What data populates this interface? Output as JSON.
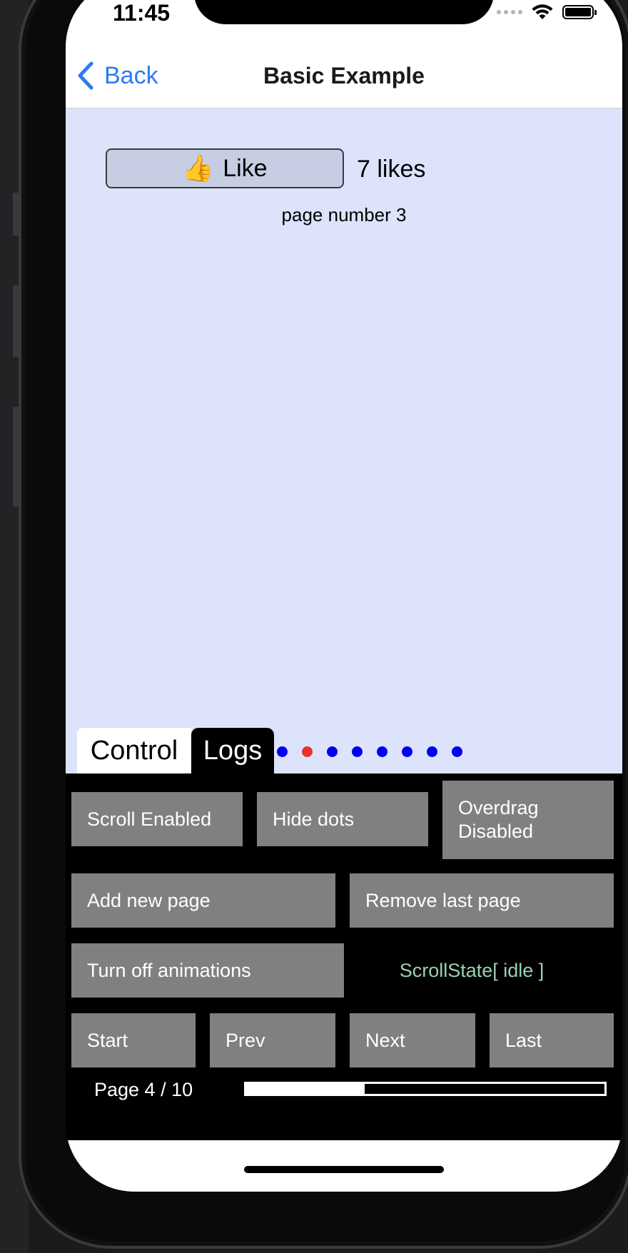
{
  "status": {
    "time": "11:45"
  },
  "nav": {
    "back_label": "Back",
    "title": "Basic Example"
  },
  "content": {
    "like_button_label": "Like",
    "likes_count": "7 likes",
    "page_number_label": "page number 3"
  },
  "tabs": [
    {
      "label": "Control",
      "active": false
    },
    {
      "label": "Logs",
      "active": true
    }
  ],
  "dots": {
    "count": 8,
    "active_index": 1,
    "active_color": "#e8322a",
    "inactive_color": "#0000f0"
  },
  "controls": {
    "scroll_enabled": "Scroll Enabled",
    "hide_dots": "Hide dots",
    "overdrag_line1": "Overdrag",
    "overdrag_line2": "Disabled",
    "add_new_page": "Add new page",
    "remove_last_page": "Remove last page",
    "turn_off_animations": "Turn off animations",
    "scroll_state": "ScrollState[ idle ]",
    "start": "Start",
    "prev": "Prev",
    "next": "Next",
    "last": "Last"
  },
  "pager": {
    "label": "Page 4 / 10",
    "progress_fraction": 0.33
  },
  "colors": {
    "content_bg": "#dde3fb",
    "button_gray": "#808080",
    "link_blue": "#2f7bf0",
    "scroll_state_text": "#9bd1b0"
  }
}
